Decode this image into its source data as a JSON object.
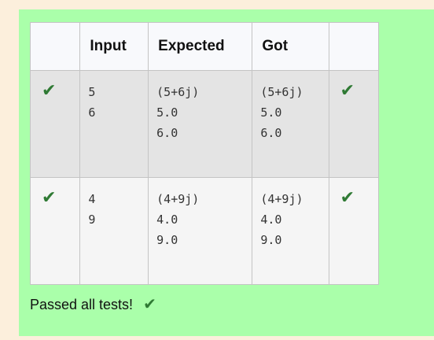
{
  "table": {
    "headers": [
      "",
      "Input",
      "Expected",
      "Got",
      ""
    ],
    "rows": [
      {
        "status_icon": "✔",
        "input": "5\n6",
        "expected": "(5+6j)\n5.0\n6.0",
        "got": "(5+6j)\n5.0\n6.0",
        "result_icon": "✔"
      },
      {
        "status_icon": "✔",
        "input": "4\n9",
        "expected": "(4+9j)\n4.0\n9.0",
        "got": "(4+9j)\n4.0\n9.0",
        "result_icon": "✔"
      }
    ]
  },
  "summary": {
    "text": "Passed all tests!",
    "icon": "✔"
  },
  "colors": {
    "panel_background": "#aaffaa",
    "page_background": "#fcefdc",
    "check_color": "#2f7a34"
  }
}
